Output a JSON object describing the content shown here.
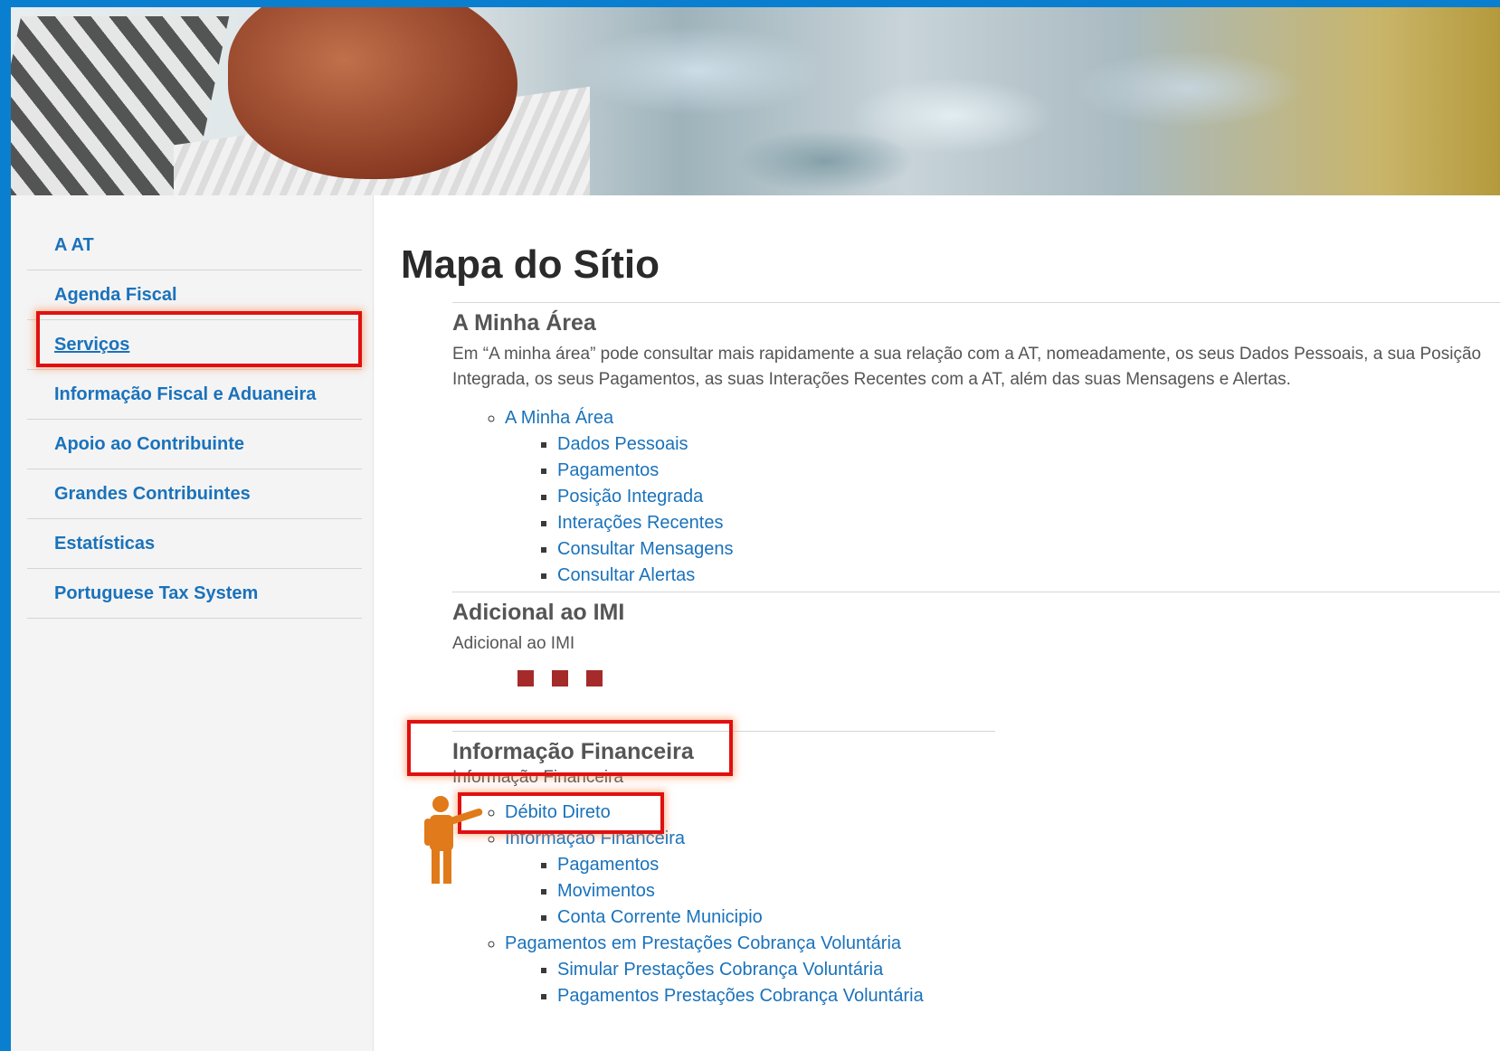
{
  "sidebar": {
    "items": [
      {
        "label": "A AT"
      },
      {
        "label": "Agenda Fiscal"
      },
      {
        "label": "Serviços"
      },
      {
        "label": "Informação Fiscal e Aduaneira"
      },
      {
        "label": "Apoio ao Contribuinte"
      },
      {
        "label": "Grandes Contribuintes"
      },
      {
        "label": "Estatísticas"
      },
      {
        "label": "Portuguese Tax System"
      }
    ]
  },
  "main": {
    "title": "Mapa do Sítio",
    "sections": [
      {
        "heading": "A Minha Área",
        "description": "Em “A minha área” pode consultar mais rapidamente a sua relação com a AT, nomeadamente, os seus Dados Pessoais, a sua Posição Integrada, os seus Pagamentos, as suas Interações Recentes com a AT, além das suas Mensagens e Alertas.",
        "links": [
          {
            "label": "A Minha Área",
            "children": [
              "Dados Pessoais",
              "Pagamentos",
              "Posição Integrada",
              "Interações Recentes",
              "Consultar Mensagens",
              "Consultar Alertas"
            ]
          }
        ]
      },
      {
        "heading": "Adicional ao IMI",
        "description": "Adicional ao IMI"
      },
      {
        "heading": "Informação Financeira",
        "description": "Informação Financeira",
        "links": [
          {
            "label": "Débito Direto"
          },
          {
            "label": "Informação Financeira",
            "children": [
              "Pagamentos",
              "Movimentos",
              "Conta Corrente Municipio"
            ]
          },
          {
            "label": "Pagamentos em Prestações Cobrança Voluntária",
            "children": [
              "Simular Prestações Cobrança Voluntária",
              "Pagamentos Prestações Cobrança Voluntária"
            ]
          }
        ]
      }
    ]
  },
  "colors": {
    "link": "#1a72bb",
    "highlight": "#e01010",
    "accent_blue": "#0a7fd0",
    "dots": "#a52a2a",
    "person": "#e07a1a"
  }
}
